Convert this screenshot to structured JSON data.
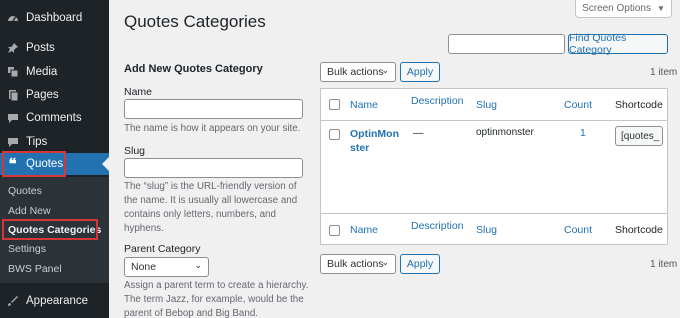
{
  "menu": {
    "items": [
      {
        "label": "Dashboard",
        "icon": "dashboard-icon"
      },
      {
        "label": "Posts",
        "icon": "pin-icon"
      },
      {
        "label": "Media",
        "icon": "media-icon"
      },
      {
        "label": "Pages",
        "icon": "pages-icon"
      },
      {
        "label": "Comments",
        "icon": "comments-icon"
      },
      {
        "label": "Tips",
        "icon": "tips-icon"
      },
      {
        "label": "Quotes",
        "icon": "quote-icon"
      },
      {
        "label": "Appearance",
        "icon": "appearance-icon"
      }
    ],
    "submenu": [
      "Quotes",
      "Add New",
      "Quotes Categories",
      "Settings",
      "BWS Panel"
    ]
  },
  "page_title": "Quotes Categories",
  "screen_options": "Screen Options",
  "search_button": "Find Quotes Category",
  "form": {
    "heading": "Add New Quotes Category",
    "name_label": "Name",
    "name_desc": "The name is how it appears on your site.",
    "slug_label": "Slug",
    "slug_desc": [
      "The “slug” is the URL-friendly version of",
      "the name. It is usually all lowercase and",
      "contains only letters, numbers, and",
      "hyphens."
    ],
    "parent_label": "Parent Category",
    "parent_value": "None",
    "parent_desc": [
      "Assign a parent term to create a hierarchy.",
      "The term Jazz, for example, would be the",
      "parent of Bebop and Big Band."
    ]
  },
  "bulk": {
    "label": "Bulk actions",
    "apply": "Apply",
    "items_count": "1 item"
  },
  "table": {
    "columns": [
      "Name",
      "Description",
      "Slug",
      "Count",
      "Shortcode"
    ],
    "rows": [
      {
        "name_line1": "OptinMon",
        "name_line2": "ster",
        "description": "—",
        "slug": "optinmonster",
        "count": "1",
        "shortcode": "[quotes_"
      }
    ]
  }
}
